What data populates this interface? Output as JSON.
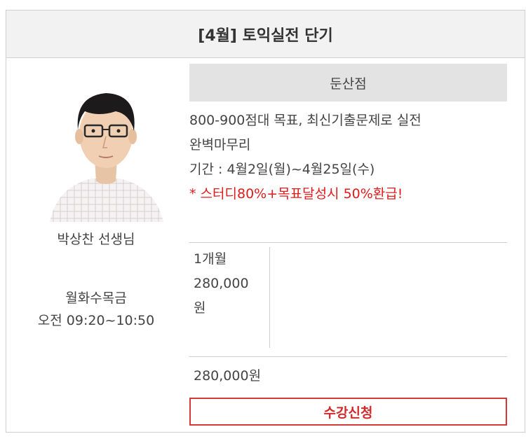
{
  "course": {
    "title": "[4월] 토익실전 단기",
    "branch": "둔산점",
    "description_line1": "800-900점대 목표, 최신기출문제로 실전",
    "description_line2": "완벽마무리",
    "period": "기간 : 4월2일(월)~4월25일(수)",
    "promo": "* 스터디80%+목표달성시 50%환급!"
  },
  "teacher": {
    "name": "박상찬 선생님",
    "days": "월화수목금",
    "time": "오전 09:20~10:50"
  },
  "pricing": {
    "duration": "1개월",
    "amount": "280,000",
    "unit": "원",
    "total": "280,000원"
  },
  "actions": {
    "enroll_label": "수강신청"
  },
  "colors": {
    "accent_red": "#d22a2a",
    "header_bg": "#f2f2f2",
    "branch_bg": "#e3e3e3"
  }
}
